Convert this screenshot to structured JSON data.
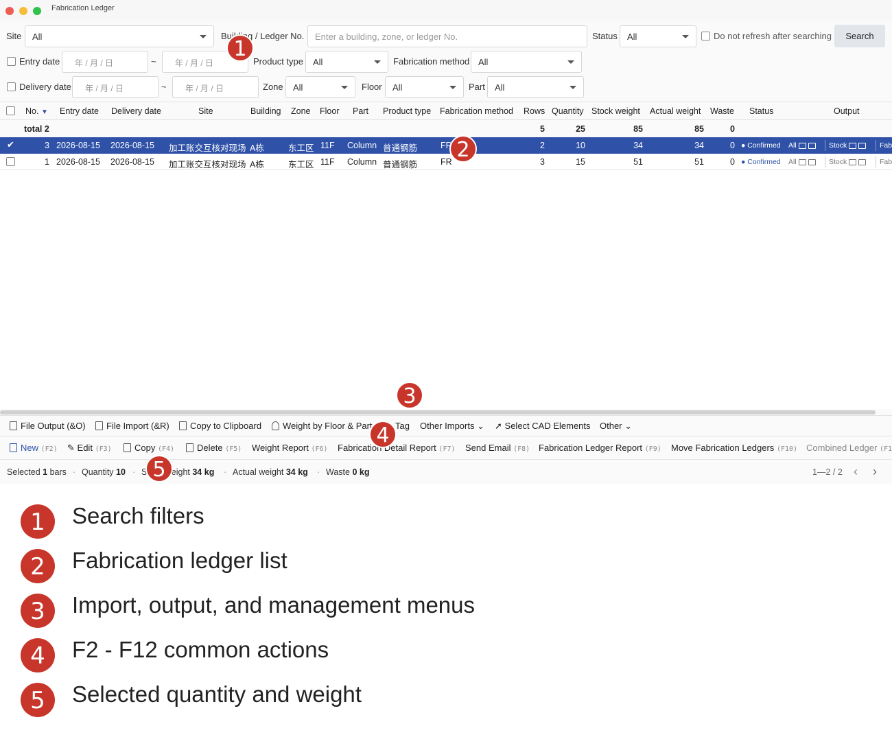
{
  "window": {
    "title": "Fabrication Ledger"
  },
  "filters": {
    "site_label": "Site",
    "site_value": "All",
    "ledger_label": "Building / Ledger No.",
    "ledger_placeholder": "Enter a building, zone, or ledger No.",
    "status_label": "Status",
    "status_value": "All",
    "no_refresh_label": "Do not refresh after searching",
    "search_button": "Search",
    "entry_date_label": "Entry date",
    "date_placeholder": "年 / 月 / 日",
    "tilde": "~",
    "product_type_label": "Product type",
    "product_type_value": "All",
    "fab_method_label": "Fabrication method",
    "fab_method_value": "All",
    "delivery_date_label": "Delivery date",
    "zone_label": "Zone",
    "zone_value": "All",
    "floor_label": "Floor",
    "floor_value": "All",
    "part_label": "Part",
    "part_value": "All"
  },
  "table": {
    "headers": [
      "No.",
      "Entry date",
      "Delivery date",
      "Site",
      "Building",
      "Zone",
      "Floor",
      "Part",
      "Product type",
      "Fabrication method",
      "Rows",
      "Quantity",
      "Stock weight",
      "Actual weight",
      "Waste",
      "Status",
      "Output"
    ],
    "sort_indicator": "▼",
    "total": {
      "label": "total 2",
      "rows": "5",
      "quantity": "25",
      "stock_weight": "85",
      "actual_weight": "85",
      "waste": "0"
    },
    "rows": [
      {
        "selected": true,
        "no": "3",
        "entry_date": "2026-08-15",
        "delivery_date": "2026-08-15",
        "site": "加工账交互核对现场",
        "building": "A栋",
        "zone": "东工区",
        "floor": "11F",
        "part": "Column",
        "product_type": "普通钢筋",
        "fab_method": "FR",
        "rows": "2",
        "quantity": "10",
        "stock_weight": "34",
        "actual_weight": "34",
        "waste": "0",
        "status": "Confirmed",
        "out_all": "All",
        "out_stock": "Stock",
        "out_fab": "Fab"
      },
      {
        "selected": false,
        "no": "1",
        "entry_date": "2026-08-15",
        "delivery_date": "2026-08-15",
        "site": "加工账交互核对现场",
        "building": "A栋",
        "zone": "东工区",
        "floor": "11F",
        "part": "Column",
        "product_type": "普通钢筋",
        "fab_method": "FR",
        "rows": "3",
        "quantity": "15",
        "stock_weight": "51",
        "actual_weight": "51",
        "waste": "0",
        "status": "Confirmed",
        "out_all": "All",
        "out_stock": "Stock",
        "out_fab": "Fab"
      }
    ]
  },
  "menu": {
    "file_output": "File Output (&O)",
    "file_import": "File Import (&R)",
    "copy_clipboard": "Copy to Clipboard",
    "weight_floor": "Weight by Floor & Part",
    "tag": "Tag",
    "other_imports": "Other Imports",
    "select_cad": "Select CAD Elements",
    "other": "Other"
  },
  "toolbar": {
    "new_label": "New",
    "new_key": "(F2)",
    "edit_label": "Edit",
    "edit_key": "(F3)",
    "copy_label": "Copy",
    "copy_key": "(F4)",
    "delete_label": "Delete",
    "delete_key": "(F5)",
    "weight_report_label": "Weight Report",
    "weight_report_key": "(F6)",
    "detail_report_label": "Fabrication Detail Report",
    "detail_report_key": "(F7)",
    "send_email_label": "Send Email",
    "send_email_key": "(F8)",
    "ledger_report_label": "Fabrication Ledger Report",
    "ledger_report_key": "(F9)",
    "move_label": "Move Fabrication Ledgers",
    "move_key": "(F10)",
    "combined_label": "Combined Ledger",
    "combined_key": "(F1"
  },
  "statusbar": {
    "selected_prefix": "Selected",
    "selected_value": "1",
    "selected_suffix": "bars",
    "quantity_label": "Quantity",
    "quantity_value": "10",
    "stock_label": "Stock weight",
    "stock_value": "34 kg",
    "actual_label": "Actual weight",
    "actual_value": "34 kg",
    "waste_label": "Waste",
    "waste_value": "0 kg",
    "pagination": "1—2 / 2",
    "prev": "‹",
    "next": "›"
  },
  "markers": [
    "1",
    "2",
    "3",
    "4",
    "5"
  ],
  "legend": [
    {
      "num": "1",
      "text": "Search filters"
    },
    {
      "num": "2",
      "text": "Fabrication ledger list"
    },
    {
      "num": "3",
      "text": "Import, output, and management menus"
    },
    {
      "num": "4",
      "text": "F2 - F12 common actions"
    },
    {
      "num": "5",
      "text": "Selected quantity and weight"
    }
  ],
  "colors": {
    "accent": "#2f52a8",
    "marker": "#c8352a",
    "status": "#2f52a8"
  }
}
